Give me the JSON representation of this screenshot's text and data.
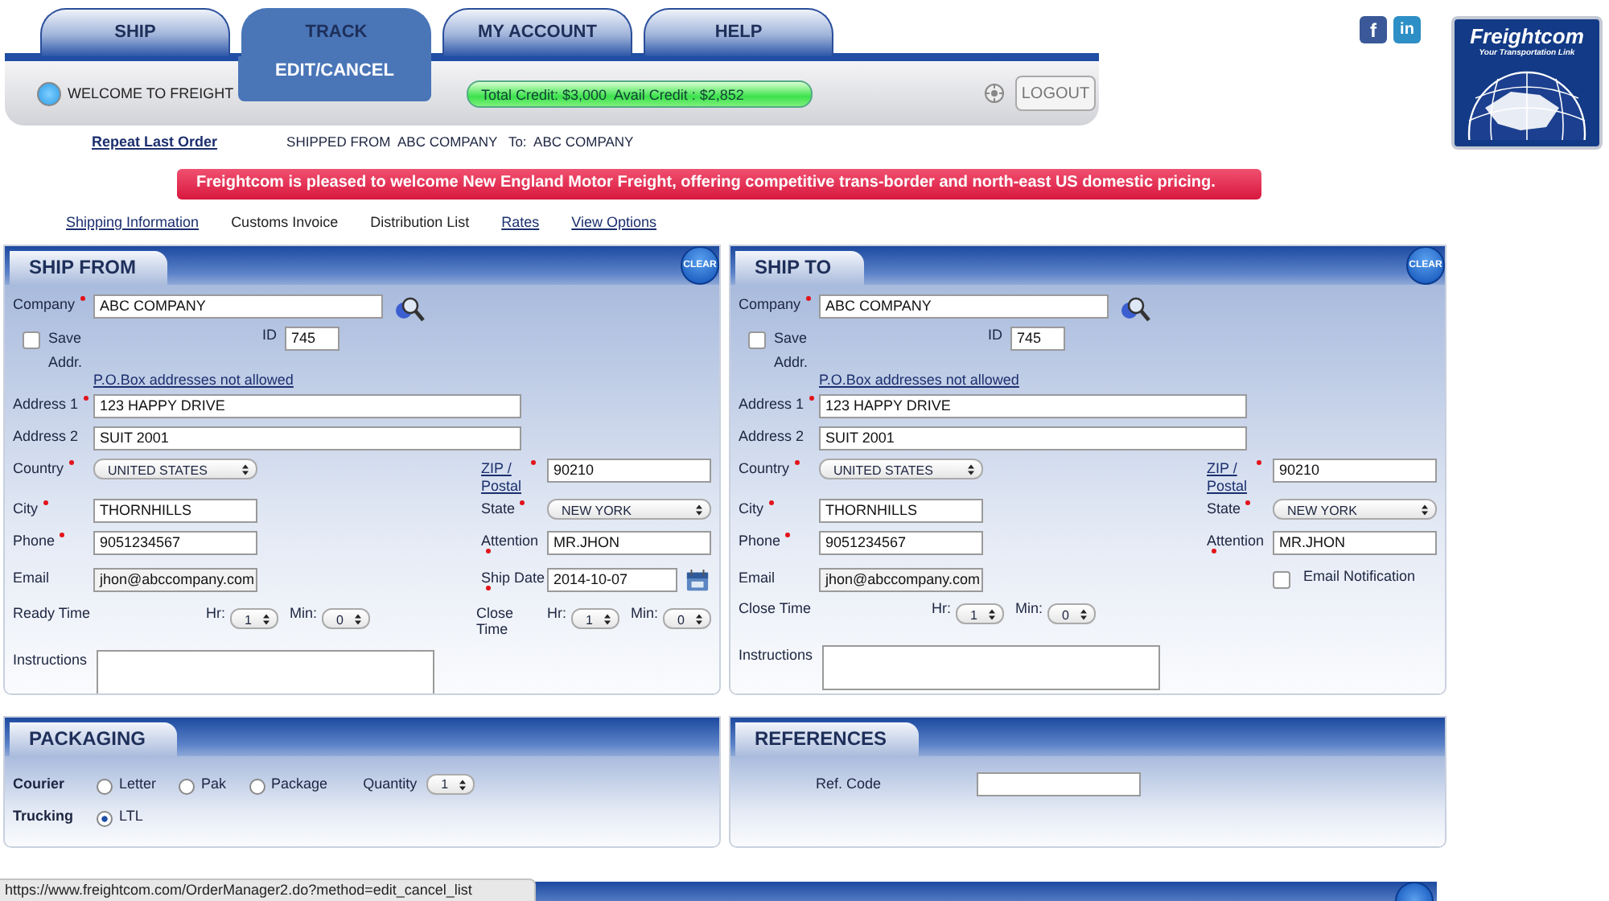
{
  "tabs": [
    {
      "label": "SHIP",
      "selected": false
    },
    {
      "label": "TRACK",
      "selected": true
    },
    {
      "label": "MY ACCOUNT",
      "selected": false
    },
    {
      "label": "HELP",
      "selected": false
    }
  ],
  "welcome": "WELCOME TO FREIGHT",
  "submenu": {
    "label": "EDIT/CANCEL"
  },
  "credit": "Total Credit: $3,000  Avail Credit : $2,852",
  "logout": "LOGOUT",
  "social": [
    {
      "kind": "facebook",
      "glyph": "f"
    },
    {
      "kind": "linkedin",
      "glyph": "in"
    }
  ],
  "logo": {
    "name": "Freightcom",
    "tagline": "Your Transportation Link"
  },
  "repeat_link": "Repeat Last Order",
  "shipped_summary": "SHIPPED FROM  ABC COMPANY   To:  ABC COMPANY",
  "banner": "Freightcom is pleased to welcome New England Motor Freight, offering competitive trans-border and north-east US domestic pricing.",
  "section_links": [
    {
      "label": "Shipping Information",
      "link": true
    },
    {
      "label": "Customs Invoice",
      "link": false
    },
    {
      "label": "Distribution List",
      "link": false
    },
    {
      "label": "Rates",
      "link": true
    },
    {
      "label": "View Options",
      "link": true
    }
  ],
  "ship_from": {
    "title": "SHIP FROM",
    "clear": "CLEAR",
    "company": {
      "label": "Company",
      "required": true,
      "value": "ABC COMPANY"
    },
    "save_address": {
      "label": "Save Addr.",
      "checked": false
    },
    "id": {
      "label": "ID",
      "value": "745"
    },
    "po_box_note": "P.O.Box addresses not allowed",
    "address_1": {
      "label": "Address 1",
      "required": true,
      "value": "123 HAPPY DRIVE"
    },
    "address_2": {
      "label": "Address 2",
      "required": false,
      "value": "SUIT 2001"
    },
    "country": {
      "label": "Country",
      "required": true,
      "value": "UNITED STATES"
    },
    "zip": {
      "label": "ZIP / Postal",
      "required": true,
      "value": "90210"
    },
    "city": {
      "label": "City",
      "required": true,
      "value": "THORNHILLS"
    },
    "state": {
      "label": "State",
      "required": true,
      "value": "NEW YORK"
    },
    "phone": {
      "label": "Phone",
      "required": true,
      "value": "9051234567"
    },
    "attention": {
      "label": "Attention",
      "required": true,
      "value": "MR.JHON"
    },
    "email": {
      "label": "Email",
      "required": false,
      "value": "jhon@abccompany.com"
    },
    "ship_date": {
      "label": "Ship Date",
      "required": true,
      "value": "2014-10-07"
    },
    "times": [
      {
        "label": "Ready Time",
        "hour_label": "Hr:",
        "hour": "1",
        "minute_label": "Min:",
        "minute": "0"
      },
      {
        "label": "Close Time",
        "hour_label": "Hr:",
        "hour": "1",
        "minute_label": "Min:",
        "minute": "0"
      }
    ],
    "instructions": {
      "label": "Instructions"
    }
  },
  "ship_to": {
    "title": "SHIP TO",
    "clear": "CLEAR",
    "company": {
      "label": "Company",
      "required": true,
      "value": "ABC COMPANY"
    },
    "save_address": {
      "label": "Save Addr.",
      "checked": false
    },
    "id": {
      "label": "ID",
      "value": "745"
    },
    "po_box_note": "P.O.Box addresses not allowed",
    "address_1": {
      "label": "Address 1",
      "required": true,
      "value": "123 HAPPY DRIVE"
    },
    "address_2": {
      "label": "Address 2",
      "required": false,
      "value": "SUIT 2001"
    },
    "country": {
      "label": "Country",
      "required": true,
      "value": "UNITED STATES"
    },
    "zip": {
      "label": "ZIP / Postal",
      "required": true,
      "value": "90210"
    },
    "city": {
      "label": "City",
      "required": true,
      "value": "THORNHILLS"
    },
    "state": {
      "label": "State",
      "required": true,
      "value": "NEW YORK"
    },
    "phone": {
      "label": "Phone",
      "required": true,
      "value": "9051234567"
    },
    "attention": {
      "label": "Attention",
      "required": true,
      "value": "MR.JHON"
    },
    "email": {
      "label": "Email",
      "required": false,
      "value": "jhon@abccompany.com"
    },
    "email_notification": {
      "label": "Email Notification",
      "checked": false
    },
    "times": [
      {
        "label": "Close Time",
        "hour_label": "Hr:",
        "hour": "1",
        "minute_label": "Min:",
        "minute": "0"
      }
    ],
    "instructions": {
      "label": "Instructions"
    }
  },
  "packaging": {
    "title": "PACKAGING",
    "rows": [
      {
        "label": "Courier",
        "options": [
          {
            "label": "Letter",
            "selected": false
          },
          {
            "label": "Pak",
            "selected": false
          },
          {
            "label": "Package",
            "selected": false
          }
        ],
        "quantity": {
          "label": "Quantity",
          "value": "1"
        }
      },
      {
        "label": "Trucking",
        "options": [
          {
            "label": "LTL",
            "selected": true
          }
        ]
      }
    ]
  },
  "references": {
    "title": "REFERENCES",
    "ref_code": {
      "label": "Ref. Code"
    }
  },
  "status_url": "https://www.freightcom.com/OrderManager2.do?method=edit_cancel_list"
}
